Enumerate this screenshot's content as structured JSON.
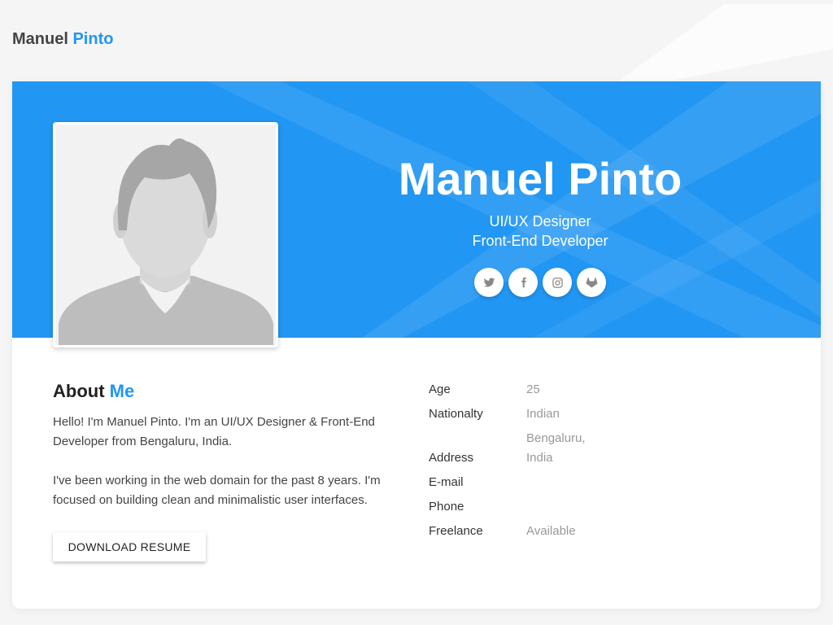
{
  "brand": {
    "first": "Manuel",
    "last": "Pinto"
  },
  "hero": {
    "name": "Manuel Pinto",
    "roles": [
      "UI/UX Designer",
      "Front-End Developer"
    ],
    "social": [
      {
        "name": "twitter-icon"
      },
      {
        "name": "facebook-icon"
      },
      {
        "name": "instagram-icon"
      },
      {
        "name": "gitlab-icon"
      }
    ]
  },
  "about": {
    "title_first": "About",
    "title_accent": "Me",
    "paragraphs": [
      "Hello! I'm Manuel Pinto. I'm an UI/UX Designer & Front-End Developer from Bengaluru, India.",
      "I've been working in the web domain for the past 8 years. I'm focused on building clean and minimalistic user interfaces."
    ],
    "resume_label": "DOWNLOAD RESUME"
  },
  "info": {
    "age": {
      "label": "Age",
      "value": "25"
    },
    "nationality": {
      "label": "Nationalty",
      "value": "Indian"
    },
    "address": {
      "label": "Address",
      "value_line1": "Bengaluru,",
      "value_line2": "India"
    },
    "email": {
      "label": "E-mail",
      "value": ""
    },
    "phone": {
      "label": "Phone",
      "value": ""
    },
    "freelance": {
      "label": "Freelance",
      "value": "Available"
    }
  },
  "colors": {
    "accent": "#2196f3",
    "background": "#f5f5f5",
    "card": "#ffffff"
  }
}
